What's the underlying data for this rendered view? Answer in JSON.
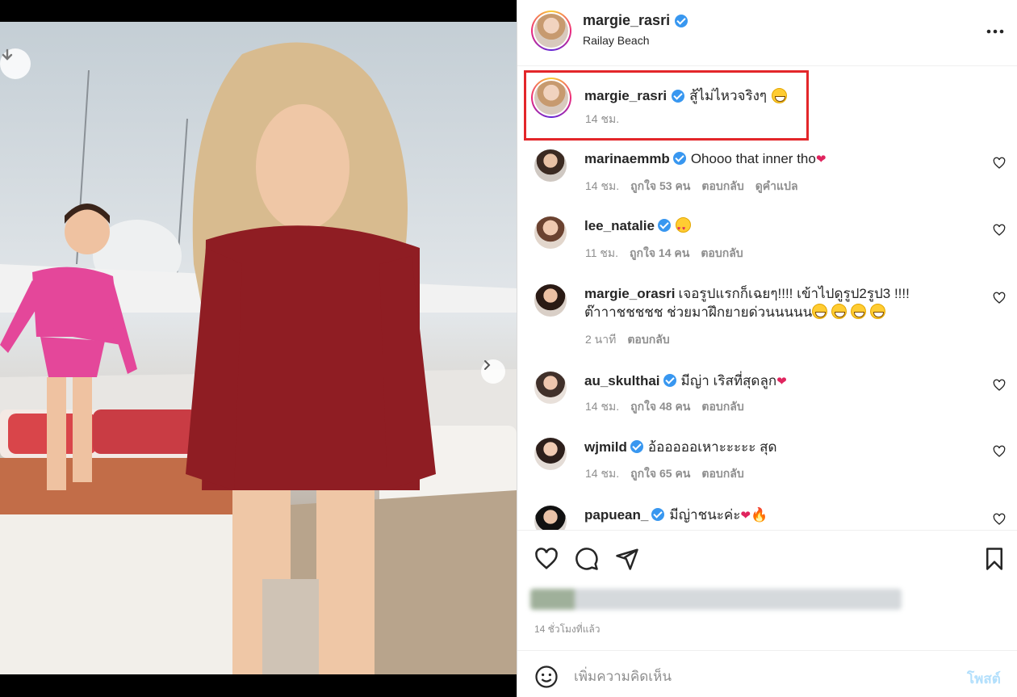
{
  "post": {
    "username": "margie_rasri",
    "location": "Railay Beach",
    "caption": "สู้ไม่ไหวจริงๆ",
    "caption_time": "14 ชม.",
    "time_ago": "14 ชั่วโมงที่แล้ว"
  },
  "comments": [
    {
      "user": "marinaemmb",
      "verified": true,
      "text": "Ohooo that inner tho",
      "time": "14 ชม.",
      "likes": "ถูกใจ 53 คน",
      "reply": "ตอบกลับ",
      "translate": "ดูคำแปล"
    },
    {
      "user": "lee_natalie",
      "verified": true,
      "text": "",
      "time": "11 ชม.",
      "likes": "ถูกใจ 14 คน",
      "reply": "ตอบกลับ"
    },
    {
      "user": "margie_orasri",
      "verified": false,
      "text": "เจอรูปแรกก็เฉยๆ!!!! เข้าไปดูรูป2รูป3 !!!!",
      "text2": "ต๊าาาชชชชช ช่วยมาฝึกยายด่วนนนนน",
      "time": "2 นาที",
      "reply": "ตอบกลับ"
    },
    {
      "user": "au_skulthai",
      "verified": true,
      "text": "มีญ่า เริสที่สุดลูก",
      "time": "14 ชม.",
      "likes": "ถูกใจ 48 คน",
      "reply": "ตอบกลับ"
    },
    {
      "user": "wjmild",
      "verified": true,
      "text": "อ้อออออเหาะะะะะ สุด",
      "time": "14 ชม.",
      "likes": "ถูกใจ 65 คน",
      "reply": "ตอบกลับ"
    },
    {
      "user": "papuean_",
      "verified": true,
      "text": "มีญ่าชนะค่ะ"
    }
  ],
  "composer": {
    "placeholder": "เพิ่มความคิดเห็น",
    "post_label": "โพสต์"
  },
  "colors": {
    "verified": "#3897f0",
    "highlight_border": "#e3262a",
    "post_button": "#b2dffc"
  },
  "icons": [
    "download-icon",
    "chevron-right-icon",
    "more-icon",
    "heart-icon",
    "comment-icon",
    "share-icon",
    "bookmark-icon",
    "emoji-icon"
  ]
}
